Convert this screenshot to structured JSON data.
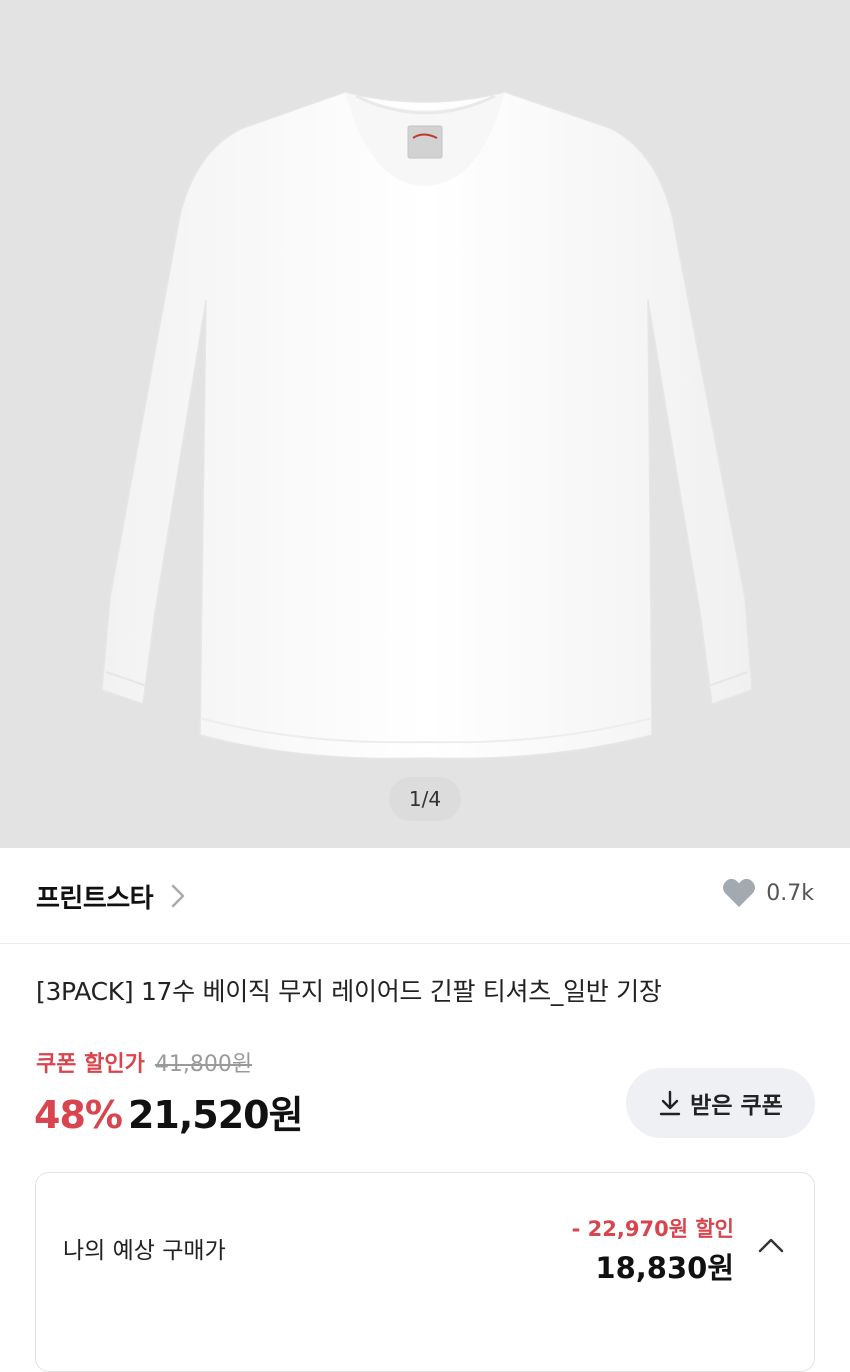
{
  "gallery": {
    "image_alt": "white long sleeve t-shirt",
    "pager": "1/4"
  },
  "brand": {
    "name": "프린트스타",
    "chevron_icon": "chevron-right-icon"
  },
  "like": {
    "icon": "heart-icon",
    "count": "0.7k"
  },
  "product": {
    "title": "[3PACK] 17수 베이직 무지 레이어드 긴팔 티셔츠_일반 기장"
  },
  "pricing": {
    "coupon_label": "쿠폰 할인가",
    "original_price": "41,800원",
    "discount_rate": "48%",
    "sale_price": "21,520원"
  },
  "coupon_button": {
    "icon": "download-icon",
    "label": "받은 쿠폰"
  },
  "estimate": {
    "label": "나의 예상 구매가",
    "discount": "- 22,970원 할인",
    "price": "18,830원",
    "toggle_icon": "chevron-up-icon"
  },
  "colors": {
    "accent": "#d9454f",
    "hero_background": "#e3e3e3"
  }
}
